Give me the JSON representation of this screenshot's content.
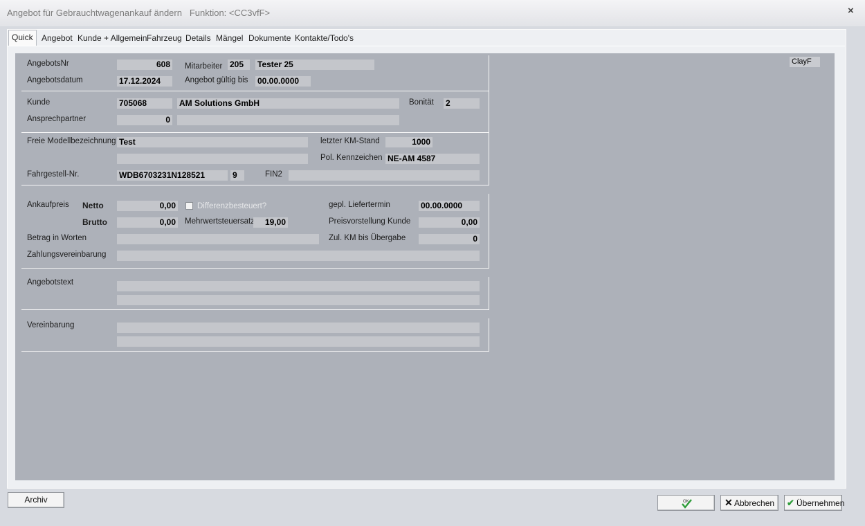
{
  "window": {
    "title": "Angebot für Gebrauchtwagenankauf ändern",
    "function_label": "Funktion: <CC3vfF>",
    "close_glyph": "×"
  },
  "tabs": [
    "Quick",
    "Angebot",
    "Kunde + Allgemein",
    "Fahrzeug",
    "Details",
    "Mängel",
    "Dokumente",
    "Kontakte/Todo's"
  ],
  "active_tab": "Quick",
  "header": {
    "angebotsnr_label": "AngebotsNr",
    "angebotsnr": "608",
    "mitarbeiter_label": "Mitarbeiter",
    "mitarbeiter_nr": "205",
    "mitarbeiter_name": "Tester 25",
    "angebotsdatum_label": "Angebotsdatum",
    "angebotsdatum": "17.12.2024",
    "gueltig_label": "Angebot gültig bis",
    "gueltig_bis": "00.00.0000",
    "user_tag": "ClayF"
  },
  "customer": {
    "kunde_label": "Kunde",
    "kunde_nr": "705068",
    "kunde_name": "AM Solutions GmbH",
    "bonitaet_label": "Bonität",
    "bonitaet": "2",
    "ansprechpartner_label": "Ansprechpartner",
    "ansprechpartner_nr": "0",
    "ansprechpartner_name": ""
  },
  "vehicle": {
    "modell_label": "Freie Modellbezeichnung",
    "modell_1": "Test",
    "modell_2": "",
    "km_label": "letzter KM-Stand",
    "km": "1000",
    "kennzeichen_label": "Pol. Kennzeichen",
    "kennzeichen": "NE-AM 4587",
    "fahrgestell_label": "Fahrgestell-Nr.",
    "fahrgestell_nr": "WDB6703231N128521",
    "pruefziffer": "9",
    "fin2_label": "FIN2",
    "fin2": ""
  },
  "price": {
    "ankaufpreis_label": "Ankaufpreis",
    "netto_label": "Netto",
    "netto": "0,00",
    "differenz_label": "Differenzbesteuert?",
    "differenz_checked": false,
    "brutto_label": "Brutto",
    "brutto": "0,00",
    "mwst_label": "Mehrwertsteuersatz",
    "mwst": "19,00",
    "liefertermin_label": "gepl. Liefertermin",
    "liefertermin": "00.00.0000",
    "preisvorstellung_label": "Preisvorstellung Kunde",
    "preisvorstellung": "0,00",
    "zul_km_label": "Zul. KM bis Übergabe",
    "zul_km": "0",
    "worten_label": "Betrag in Worten",
    "worten": "",
    "zahlung_label": "Zahlungsvereinbarung",
    "zahlung": ""
  },
  "texts": {
    "angebotstext_label": "Angebotstext",
    "angebotstext_1": "",
    "angebotstext_2": "",
    "vereinbarung_label": "Vereinbarung",
    "vereinbarung_1": "",
    "vereinbarung_2": ""
  },
  "buttons": {
    "archiv": "Archiv",
    "ok": "OK",
    "abbrechen": "Abbrechen",
    "uebernehmen": "Übernehmen"
  },
  "colors": {
    "content_bg": "#adb1b9",
    "field_bg": "#c4c6cb",
    "ok_check": "#2e9d3a"
  }
}
